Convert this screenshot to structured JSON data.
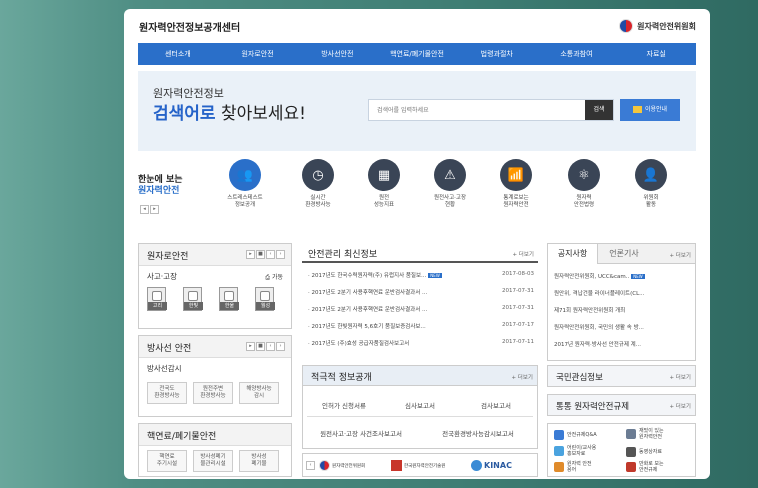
{
  "header": {
    "site_title": "원자력안전정보공개센터",
    "org_name": "원자력안전위원회"
  },
  "nav": [
    "센터소개",
    "원자로안전",
    "방사선안전",
    "핵연료/폐기물안전",
    "법령과절차",
    "소통과참여",
    "자료실"
  ],
  "search": {
    "subtitle": "원자력안전정보",
    "title_highlight": "검색어로",
    "title_rest": " 찾아보세요!",
    "placeholder": "검색어를 입력하세요",
    "button": "검색",
    "guide": "이용안내"
  },
  "quick": {
    "title_line1": "한눈에 보는",
    "title_line2": "원자력안전",
    "items": [
      {
        "icon": "people-icon",
        "glyph": "👥",
        "label1": "스트레스테스트",
        "label2": "정보공개"
      },
      {
        "icon": "clock-icon",
        "glyph": "◷",
        "label1": "실시간",
        "label2": "환경방사능"
      },
      {
        "icon": "monitor-chart-icon",
        "glyph": "▦",
        "label1": "원전",
        "label2": "성능지표"
      },
      {
        "icon": "warning-icon",
        "glyph": "⚠",
        "label1": "원전사고·고장",
        "label2": "현황"
      },
      {
        "icon": "bar-chart-icon",
        "glyph": "📶",
        "label1": "통계로보는",
        "label2": "원자력안전"
      },
      {
        "icon": "atom-icon",
        "glyph": "⚛",
        "label1": "원자력",
        "label2": "안전법령"
      },
      {
        "icon": "person-icon",
        "glyph": "👤",
        "label1": "위원회",
        "label2": "활동"
      }
    ]
  },
  "reactor": {
    "title": "원자로안전",
    "sub": "사고·고장",
    "status": "가동",
    "tiles": [
      "고리",
      "한빛",
      "한울",
      "월성"
    ]
  },
  "radiation": {
    "title": "방사선 안전",
    "sub": "방사선감시",
    "buttons": [
      {
        "l1": "전국도",
        "l2": "환경방사능"
      },
      {
        "l1": "원전주변",
        "l2": "환경방사능"
      },
      {
        "l1": "해양방사능",
        "l2": "감시"
      }
    ]
  },
  "fuel": {
    "title": "핵연료/폐기물안전",
    "buttons": [
      {
        "l1": "핵연료",
        "l2": "주기시설"
      },
      {
        "l1": "방사성폐기",
        "l2": "물관리시설"
      },
      {
        "l1": "방사성",
        "l2": "폐기물"
      }
    ]
  },
  "news": {
    "title": "안전관리 최신정보",
    "more": "+ 더보기",
    "rows": [
      {
        "text": "· 2017년도 한국수력원자력(주) 유럽지사 품질보...",
        "date": "2017-08-03",
        "badge": "NEW"
      },
      {
        "text": "· 2017년도 2분기 사용후핵연료 운반검사결과서 ...",
        "date": "2017-07-31"
      },
      {
        "text": "· 2017년도 2분기 사용후핵연료 운반검사결과서 ...",
        "date": "2017-07-31"
      },
      {
        "text": "· 2017년도 한빛원자력 5,6호기 품질보증검사보...",
        "date": "2017-07-17"
      },
      {
        "text": "· 2017년도 (주)효성 공급자품질검사보고서",
        "date": "2017-07-11"
      }
    ]
  },
  "proactive": {
    "title": "적극적 정보공개",
    "more": "+ 더보기",
    "row1": [
      "인허가 신청서류",
      "심사보고서",
      "검사보고서"
    ],
    "row2": [
      "원전사고·고장 사건조사보고서",
      "전국환경방사능감시보고서"
    ]
  },
  "logos": [
    {
      "name": "원자력안전위원회"
    },
    {
      "name": "한국원자력안전기술원"
    },
    {
      "name": "KINAC"
    }
  ],
  "notices": {
    "tab1": "공지사항",
    "tab2": "언론기사",
    "more": "+ 더보기",
    "rows": [
      {
        "text": "원자력안전위원회, UCC&cam..",
        "badge": "NEW"
      },
      {
        "text": "원안위, 격납건물 라이너플레이트(CL..."
      },
      {
        "text": "제71회 원자력안전위원회 개최"
      },
      {
        "text": "원자력안전위원회, 국민의 생활 속 방..."
      },
      {
        "text": "2017년 원자력·방사선 안전규제 계..."
      }
    ]
  },
  "interest": {
    "title": "국민관심정보",
    "more": "+ 더보기"
  },
  "regulation": {
    "title": "통통 원자력안전규제",
    "more": "+ 더보기"
  },
  "reg_links": [
    {
      "l1": "안전규제Q&A",
      "l2": ""
    },
    {
      "l1": "재밌이 있는",
      "l2": "원자력안전"
    },
    {
      "l1": "어린이/교사용",
      "l2": "홍보자료"
    },
    {
      "l1": "동영상자료",
      "l2": ""
    },
    {
      "l1": "원자력 안전",
      "l2": "용어"
    },
    {
      "l1": "만화로 보는",
      "l2": "안전규제"
    }
  ],
  "colors": {
    "brand": "#2a6fc9",
    "nav": "#2a6fc9",
    "badge": "#2a6fc9"
  }
}
